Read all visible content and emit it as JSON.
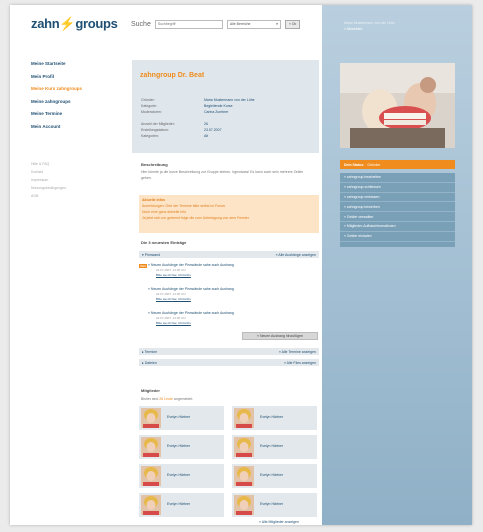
{
  "brand": {
    "logo_left": "zahn",
    "logo_right": "groups",
    "logo_mark": "lightning-bolt"
  },
  "search": {
    "label": "Suche",
    "placeholder": "Suchbegriff",
    "scope": "Alle Bereiche",
    "submit": "» Ok"
  },
  "user": {
    "name": "Maria Mustermann von der Lühe",
    "logout": "» Abmelden"
  },
  "nav": [
    {
      "label": "Meine Startseite",
      "active": false
    },
    {
      "label": "Mein Profil",
      "active": false
    },
    {
      "label": "Meine Kurs zahngroups",
      "active": true
    },
    {
      "label": "Meine zahngroups",
      "active": false
    },
    {
      "label": "Meine Termine",
      "active": false
    },
    {
      "label": "Mein Account",
      "active": false
    }
  ],
  "meta_links": [
    "Hilfe & FAQ",
    "Kontakt",
    "Impressum",
    "Nutzungsbedingungen",
    "AGB"
  ],
  "group": {
    "title": "zahngroup Dr. Beat",
    "rows": [
      {
        "k": "Gründer:",
        "v": "Maria Mustermann von der Lühe"
      },
      {
        "k": "Kategorie:",
        "v": "Begleitende Kurse"
      },
      {
        "k": "Moderatoren:",
        "v": "Carina Zumtner"
      },
      {
        "k": "Anzahl der Mitglieder:",
        "v": "26"
      },
      {
        "k": "Erstellungsdatum:",
        "v": "23.07.2007"
      },
      {
        "k": "Kategorien:",
        "v": "Alt"
      }
    ]
  },
  "description": {
    "heading": "Beschreibung",
    "text": "Hier könnte ja die kurze Beschreibung zur Gruppe stehen. Irgendwas! Es kann auch sein mehrere Zeilen gehen."
  },
  "news": {
    "title": "Aktuelle Infos",
    "lines": [
      "Anmeldungen: Orte der Termine bitte selbst im Forum",
      "Noch eine ganz aktuelle Info",
      "Ja jetzt sich um getrennt folge die zum Unterlagung von dem Fenster"
    ]
  },
  "latest": {
    "heading": "Die 3 neuesten Einträge",
    "board_label": "Pinnwand",
    "board_link": "» Alle Aushänge anzeigen",
    "new_badge": "NEU",
    "posts": [
      {
        "title": "Neuen Aushänge der Pinnwände sahe auch Aushang",
        "date": "24.07.2007, 12:00 Uhr",
        "link": "Bitte sie ob hier, Uhrzeitzu"
      },
      {
        "title": "Neuen Aushänge der Pinnwände sahe auch Aushang",
        "date": "22.07.2007, 12:00 Uhr",
        "link": "Bitte sie ob hier, Uhrzeitzu"
      },
      {
        "title": "Neuen Aushänge der Pinnwände sahe auch Aushang",
        "date": "22.07.2007, 12:00 Uhr",
        "link": "Bitte sie ob hier, Uhrzeitzu"
      }
    ],
    "add_button": "» Neuen Aushang hinzufügen"
  },
  "terms": {
    "label": "Termine",
    "link": "» Alle Termine anzeigen"
  },
  "files": {
    "label": "Dateien",
    "link": "» Alle Files anzeigen"
  },
  "members": {
    "heading": "Mitglieder",
    "sub_pre": "Bisher sind ",
    "count": "26 Leute",
    "sub_post": " angemeldet.",
    "list": [
      "Evelyn Härtner",
      "Evelyn Härtner",
      "Evelyn Härtner",
      "Evelyn Härtner",
      "Evelyn Härtner",
      "Evelyn Härtner",
      "Evelyn Härtner",
      "Evelyn Härtner"
    ],
    "all_link": "» Alle Mitglieder anzeigen"
  },
  "status": {
    "label": "Dein Status:",
    "value": "Gründer"
  },
  "actions": [
    "zahngroup bearbeiten",
    "zahngroup schliessen",
    "zahngroup verlassen",
    "zahngroup bewerben",
    "Gelder verwalten",
    "Mitglieder-Aufbauinformationen",
    "Gelder einladen"
  ],
  "colors": {
    "brand_blue": "#1f4f73",
    "accent_orange": "#f08c1e",
    "panel_blue": "#8fb0c7"
  }
}
